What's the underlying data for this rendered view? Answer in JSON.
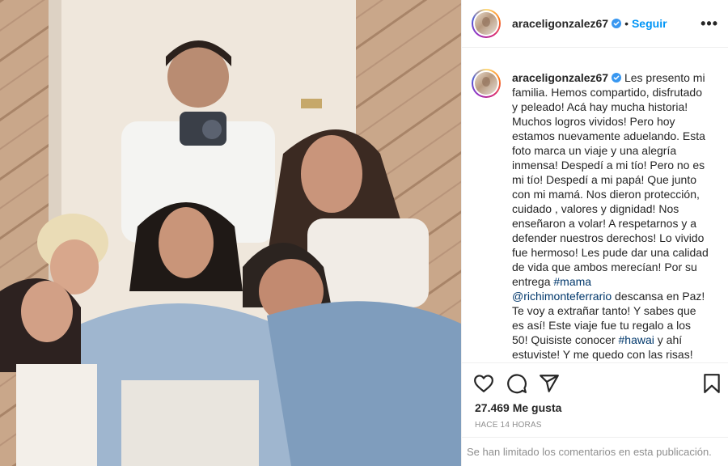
{
  "post": {
    "username": "araceligonzalez67",
    "follow_label": "Seguir",
    "dot": "•",
    "more": "•••"
  },
  "caption": {
    "username": "araceligonzalez67",
    "text_1": " Les presento mi familia. Hemos compartido, disfrutado y peleado! Acá hay mucha historia! Muchos logros vividos! Pero hoy estamos nuevamente aduelando. Esta foto marca un viaje y una alegría inmensa! Despedí a mi tío! Pero no es mi tío! Despedí a mi papá! Que junto con mi mamá. Nos dieron protección, cuidado , valores y dignidad! Nos enseñaron a volar! A respetarnos y a defender nuestros derechos! Lo vivido fue hermoso! Les pude dar una calidad de vida que ambos merecían! Por su entrega ",
    "hashtag_mama": "#mama",
    "mention": "@richimonteferrario",
    "text_2": " descansa en Paz! Te voy a extrañar tanto! Y sabes que es así! Este viaje fue tu regalo a los 50! Quisiste conocer ",
    "hashtag_hawai": "#hawai",
    "text_3": " y ahí estuviste! Y me quedo con las risas!"
  },
  "stats": {
    "likes": "27.469 Me gusta",
    "time": "HACE 14 HORAS"
  },
  "comments_limited": "Se han limitado los comentarios en esta publicación.",
  "icons": [
    "heart-icon",
    "comment-icon",
    "share-icon",
    "bookmark-icon",
    "verified-badge-icon",
    "more-options-icon"
  ],
  "colors": {
    "accent": "#0095f6",
    "link": "#00376b",
    "verified": "#3897f0",
    "muted": "#8e8e8e"
  }
}
